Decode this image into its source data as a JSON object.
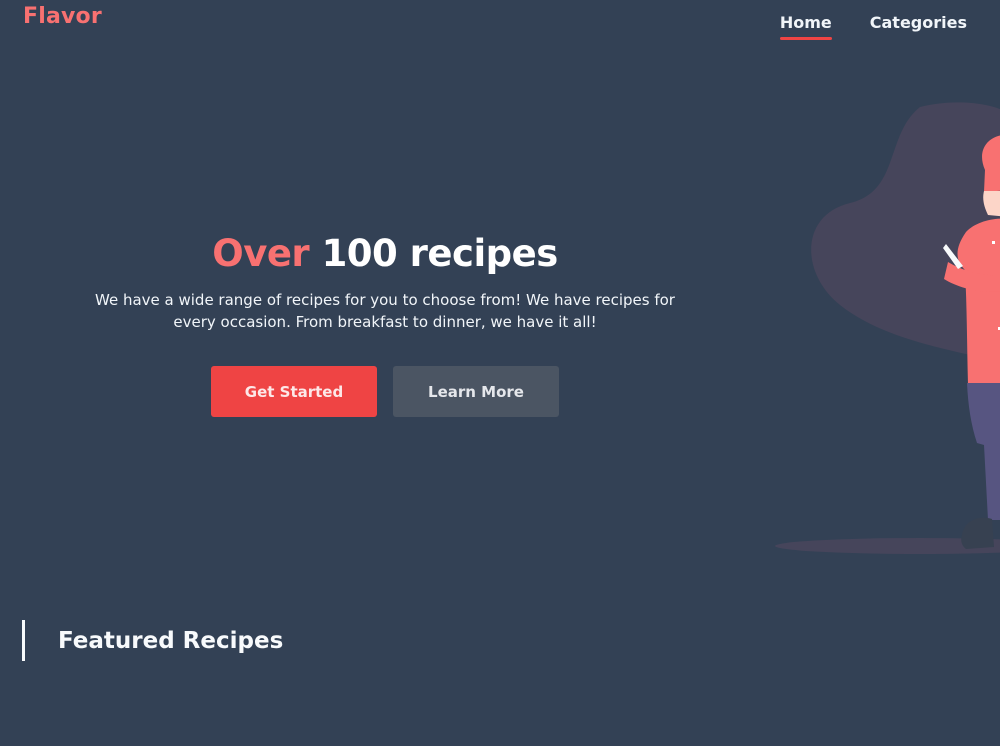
{
  "brand": {
    "name": "Flavor",
    "color": "#f87171"
  },
  "nav": {
    "items": [
      {
        "label": "Home",
        "active": true
      },
      {
        "label": "Categories",
        "active": false
      }
    ]
  },
  "hero": {
    "title_accent": "Over",
    "title_rest": "100 recipes",
    "description": "We have a wide range of recipes for you to choose from! We have recipes for every occasion. From breakfast to dinner, we have it all!",
    "primary_button": "Get Started",
    "secondary_button": "Learn More"
  },
  "illustration": {
    "icon": "chef-illustration"
  },
  "featured": {
    "title": "Featured Recipes"
  },
  "colors": {
    "background": "#334155",
    "accent": "#ef4444",
    "secondary_button": "#4b5563"
  }
}
